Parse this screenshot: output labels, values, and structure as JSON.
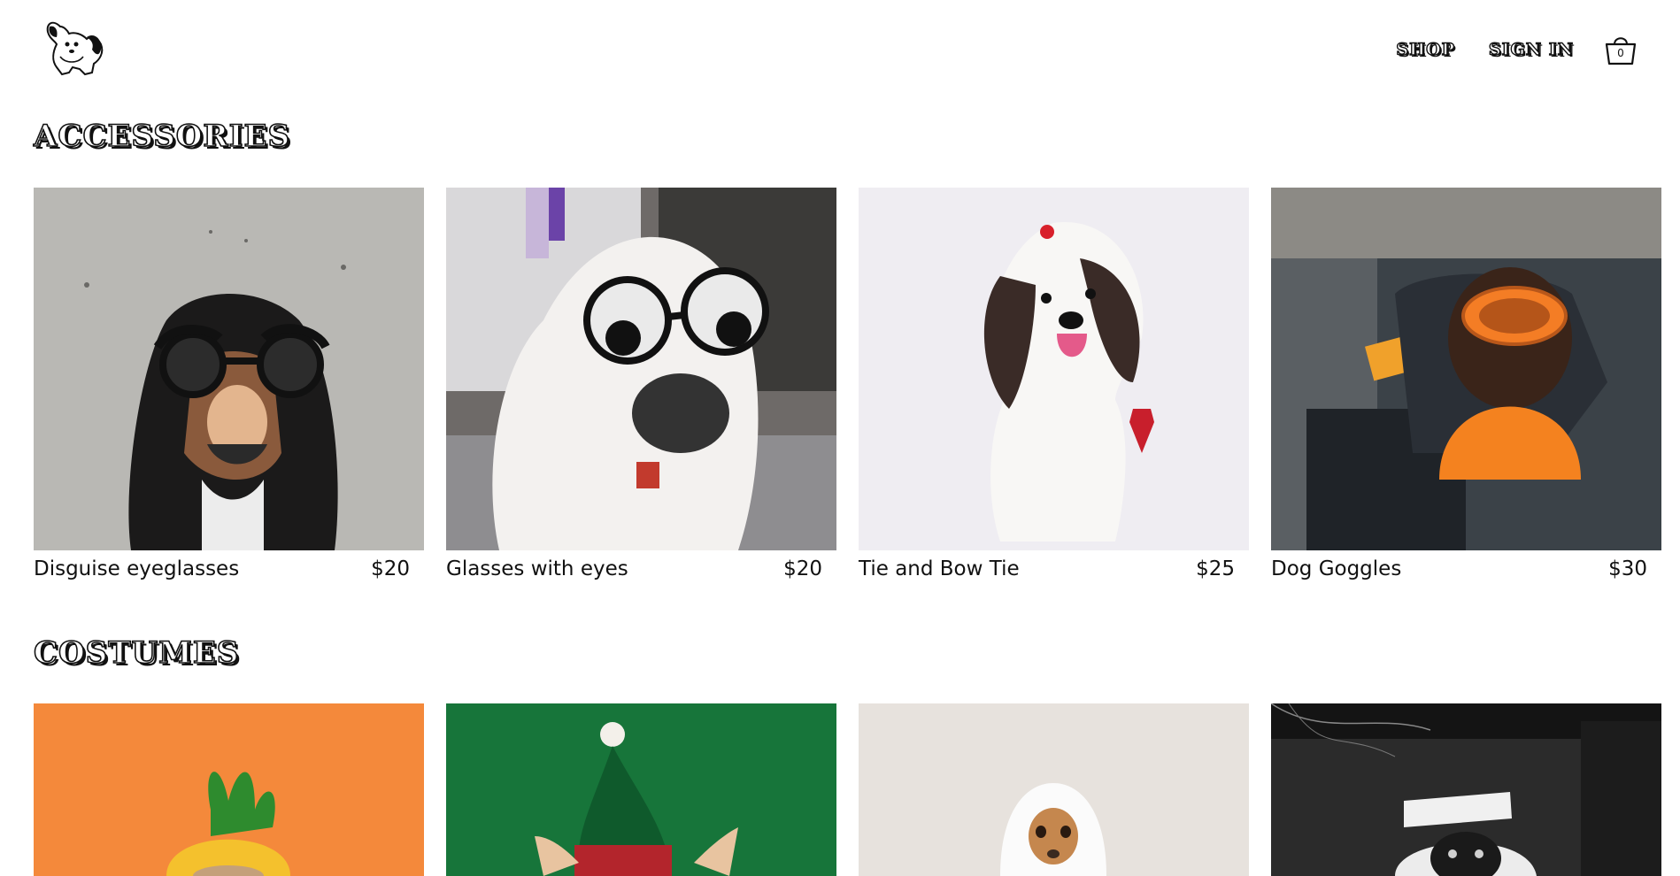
{
  "header": {
    "nav": {
      "shop": "SHOP",
      "sign_in": "SIGN IN"
    },
    "cart_count": "0"
  },
  "sections": [
    {
      "title": "ACCESSORIES",
      "products": [
        {
          "name": "Disguise eyeglasses",
          "price": "$20",
          "bg": "#b9b8b4"
        },
        {
          "name": "Glasses with eyes",
          "price": "$20",
          "bg": "#6e6a68"
        },
        {
          "name": "Tie and Bow Tie",
          "price": "$25",
          "bg": "#efedf2"
        },
        {
          "name": "Dog Goggles",
          "price": "$30",
          "bg": "#3b4248"
        }
      ]
    },
    {
      "title": "COSTUMES",
      "products": [
        {
          "bg": "#f4893b"
        },
        {
          "bg": "#17753a"
        },
        {
          "bg": "#e7e2dd"
        },
        {
          "bg": "#2b2b2b"
        }
      ]
    }
  ]
}
